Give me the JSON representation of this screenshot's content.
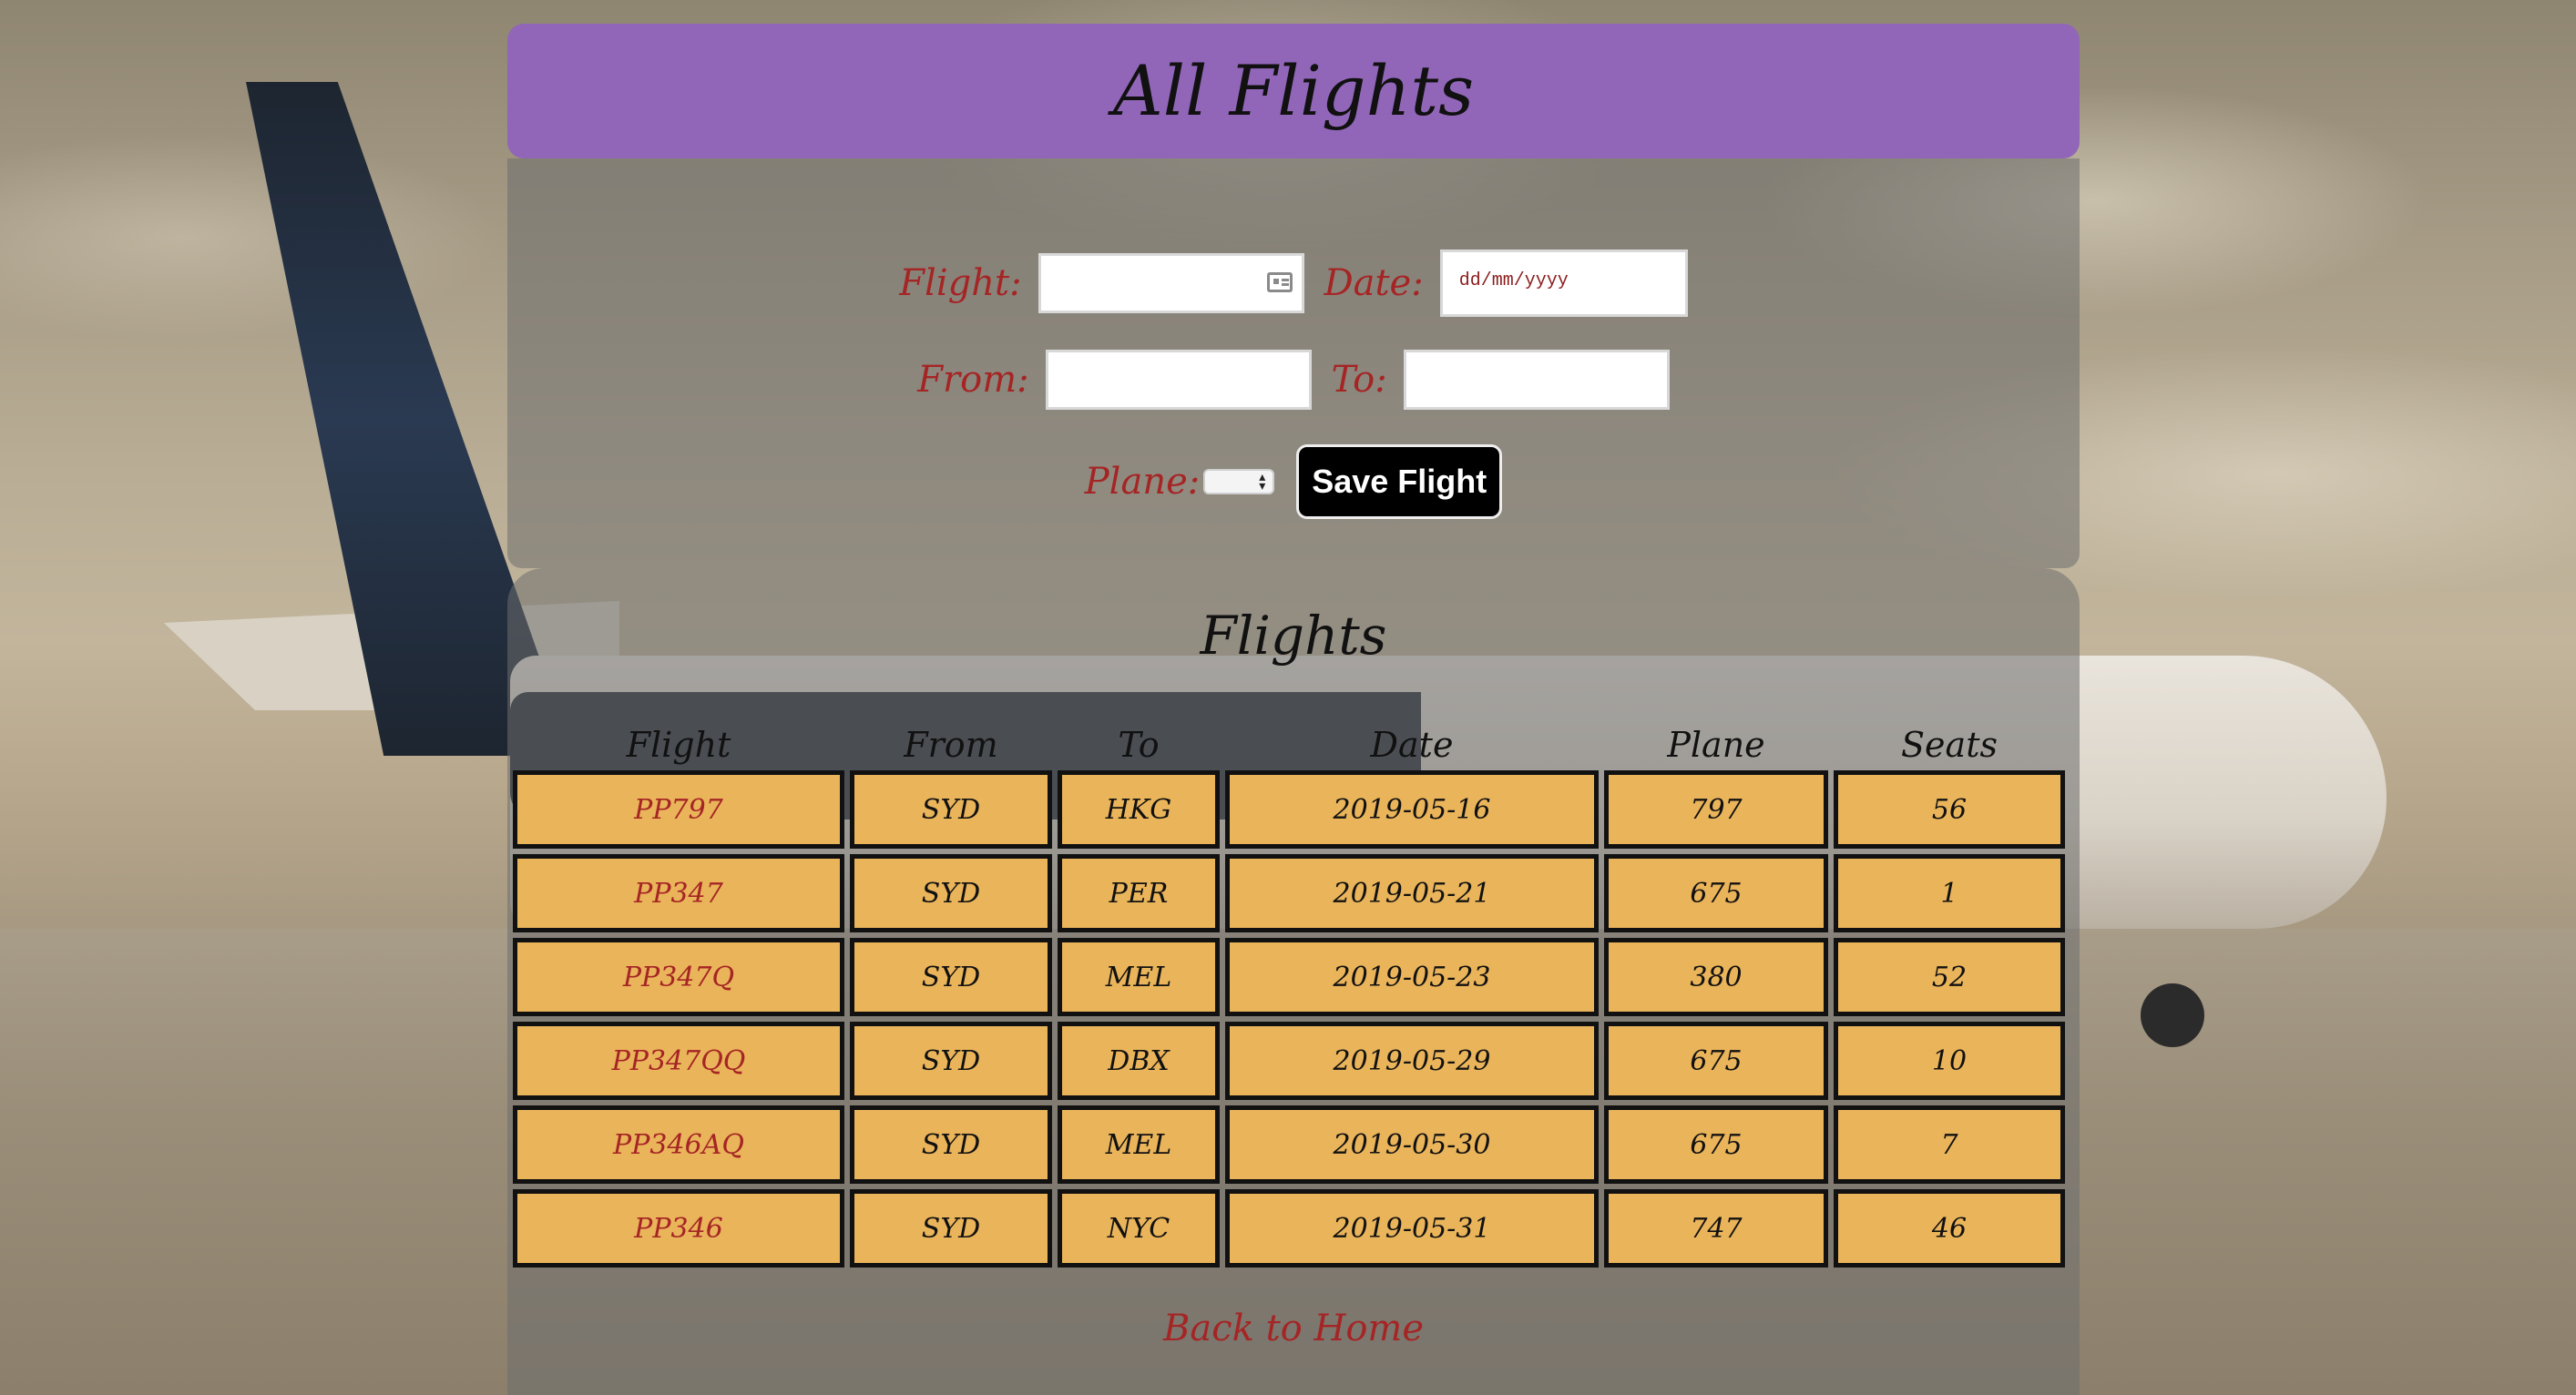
{
  "header": {
    "title": "All Flights"
  },
  "form": {
    "flight_label": "Flight:",
    "date_label": "Date:",
    "date_placeholder": "dd/mm/yyyy",
    "from_label": "From:",
    "to_label": "To:",
    "plane_label": "Plane:",
    "save_button_label": "Save Flight"
  },
  "flights_section": {
    "title": "Flights",
    "columns": [
      "Flight",
      "From",
      "To",
      "Date",
      "Plane",
      "Seats"
    ],
    "rows": [
      [
        "PP797",
        "SYD",
        "HKG",
        "2019-05-16",
        "797",
        "56"
      ],
      [
        "PP347",
        "SYD",
        "PER",
        "2019-05-21",
        "675",
        "1"
      ],
      [
        "PP347Q",
        "SYD",
        "MEL",
        "2019-05-23",
        "380",
        "52"
      ],
      [
        "PP347QQ",
        "SYD",
        "DBX",
        "2019-05-29",
        "675",
        "10"
      ],
      [
        "PP346AQ",
        "SYD",
        "MEL",
        "2019-05-30",
        "675",
        "7"
      ],
      [
        "PP346",
        "SYD",
        "NYC",
        "2019-05-31",
        "747",
        "46"
      ]
    ]
  },
  "footer": {
    "back_link": "Back to Home"
  },
  "colors": {
    "header_bg": "#9166b8",
    "cell_bg": "#eab45a",
    "label_red": "#a52525",
    "button_bg": "#000000"
  }
}
